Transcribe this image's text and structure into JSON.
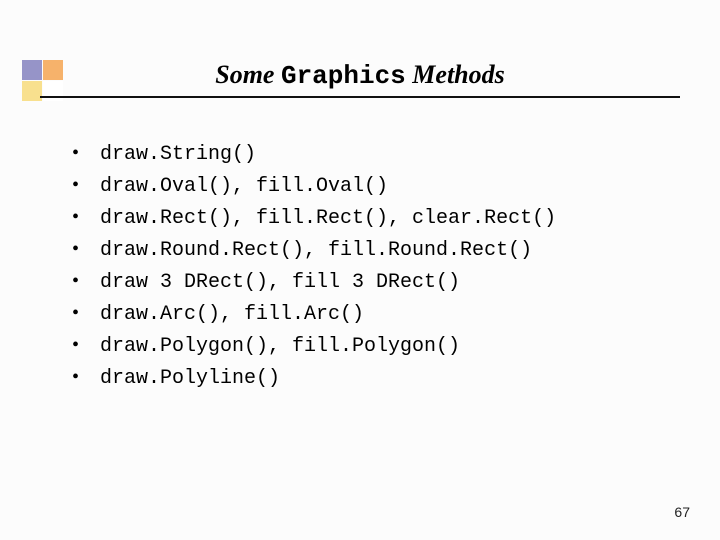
{
  "title": {
    "part1_italic": "Some ",
    "part2_mono": "Graphics",
    "part3_italic": " Methods"
  },
  "bullets": [
    "draw.String()",
    "draw.Oval(), fill.Oval()",
    "draw.Rect(), fill.Rect(), clear.Rect()",
    "draw.Round.Rect(), fill.Round.Rect()",
    "draw 3 DRect(), fill 3 DRect()",
    "draw.Arc(), fill.Arc()",
    "draw.Polygon(), fill.Polygon()",
    "draw.Polyline()"
  ],
  "bullet_glyph": "•",
  "page_number": "67"
}
